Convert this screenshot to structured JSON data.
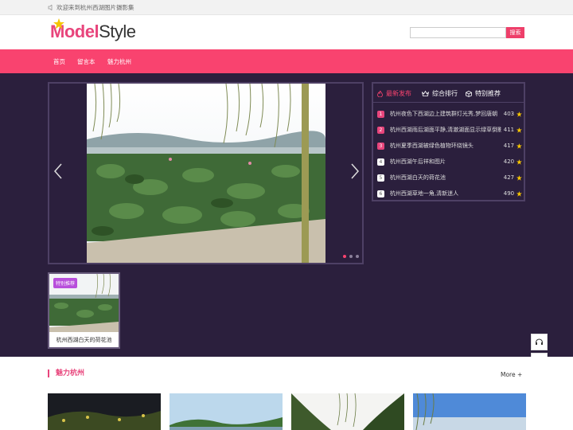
{
  "topbar": {
    "welcome": "欢迎来到杭州西湖图片摄影集"
  },
  "logo": {
    "part1": "Model",
    "part2": "Style"
  },
  "search": {
    "placeholder": "",
    "button": "搜索"
  },
  "nav": {
    "items": [
      "首页",
      "留言本",
      "魅力杭州"
    ]
  },
  "rank": {
    "tabs": [
      "最新发布",
      "综合排行",
      "特别推荐"
    ],
    "items": [
      {
        "num": "1",
        "title": "杭州夜色下西湖边上建筑群灯光秀,梦回唐朝",
        "score": "403"
      },
      {
        "num": "2",
        "title": "杭州西湖雨后湖面平静,清澈湖面显示绿草倒影",
        "score": "411"
      },
      {
        "num": "3",
        "title": "杭州夏季西湖被绿色植物环绕镜头",
        "score": "417"
      },
      {
        "num": "4",
        "title": "杭州西湖午后祥和图片",
        "score": "420"
      },
      {
        "num": "5",
        "title": "杭州西湖白天的荷花池",
        "score": "427"
      },
      {
        "num": "6",
        "title": "杭州西湖草地一角,清新迷人",
        "score": "490"
      }
    ]
  },
  "feature": {
    "badge": "特别推荐",
    "caption": "杭州西湖白天的荷花池"
  },
  "section": {
    "title": "魅力杭州",
    "more": "More +"
  },
  "colors": {
    "accent": "#f9436f",
    "dark_bg": "#2b1f3d",
    "badge": "#b84fdb"
  }
}
